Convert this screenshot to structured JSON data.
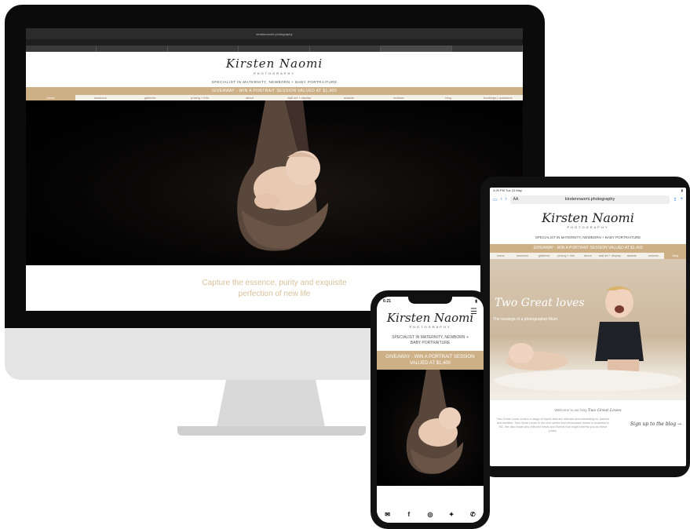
{
  "desktop": {
    "url": "kirstennaomi.photography",
    "logo_main": "Kirsten Naomi",
    "logo_sub": "PHOTOGRAPHY",
    "tagline": "SPECIALIST IN MATERNITY, NEWBORN + BABY PORTRAITURE",
    "giveaway": "GIVEAWAY - WIN A PORTRAIT SESSION VALUED AT $1,400",
    "nav": [
      "home",
      "sessions",
      "galleries",
      "pricing + info",
      "about",
      "wall art + display",
      "awards",
      "reviews",
      "blog",
      "bookings | questions"
    ],
    "capture_line1": "Capture the essence, purity and exquisite",
    "capture_line2": "perfection of new life"
  },
  "tablet": {
    "time": "3:25 PM  Tue 24 May",
    "url": "kirstennaomi.photography",
    "aa": "AA",
    "logo_main": "Kirsten Naomi",
    "logo_sub": "PHOTOGRAPHY",
    "tagline": "SPECIALIST IN MATERNITY, NEWBORN + BABY PORTRAITURE",
    "giveaway": "GIVEAWAY - WIN A PORTRAIT SESSION VALUED AT $1,400",
    "nav": [
      "home",
      "sessions",
      "galleries",
      "pricing + info",
      "about",
      "wall art + display",
      "awards",
      "reviews",
      "blog"
    ],
    "hero_title": "Two Great loves",
    "hero_sub": "The musings of a photographer Mum",
    "blog_welcome": "Welcome to our blog",
    "blog_name": "Two Great Loves",
    "blog_desc": "Two Great Loves covers a range of topics that are relevant and interesting for parents and families. Two Great Loves is our new series that showcases mums in business in NZ. We also share any relevant News and Events that might interest you as these posts.",
    "signup": "Sign up to the blog →"
  },
  "phone": {
    "time": "6:21",
    "logo_main": "Kirsten Naomi",
    "logo_sub": "PHOTOGRAPHY",
    "menu_icon": "☰",
    "tagline": "SPECIALIST IN MATERNITY, NEWBORN + BABY PORTRAITURE",
    "giveaway": "GIVEAWAY - WIN A PORTRAIT SESSION VALUED AT $1,400",
    "footer_icons": [
      "mail-icon",
      "facebook-icon",
      "instagram-icon",
      "twitter-icon",
      "phone-icon"
    ]
  },
  "colors": {
    "accent": "#cdb086",
    "accent_text": "#d8c09a",
    "dark": "#0b0b0b"
  }
}
